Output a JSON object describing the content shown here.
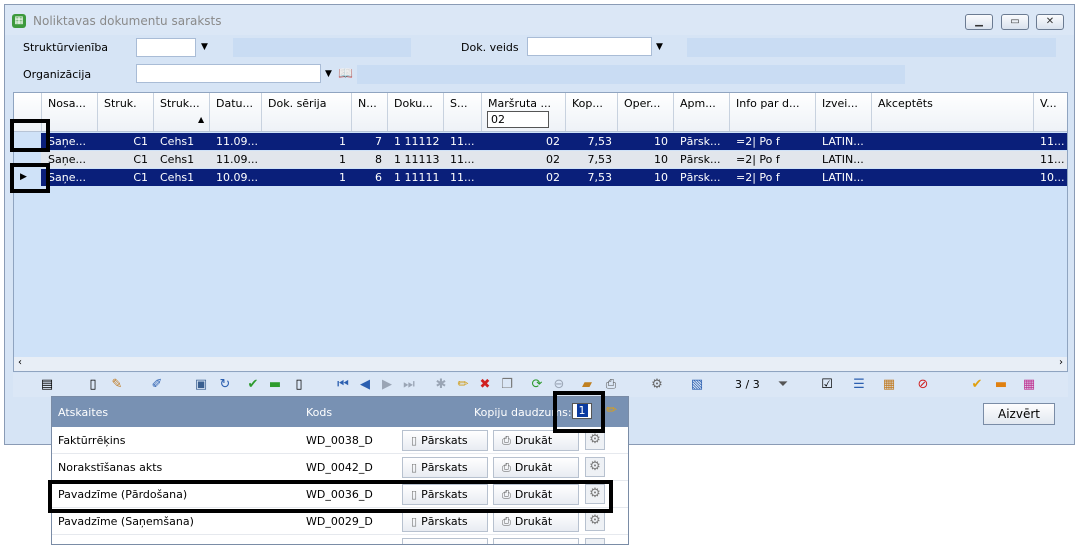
{
  "window": {
    "title": "Noliktavas dokumentu saraksts",
    "app_icon": "warehouse-app-icon"
  },
  "filters": {
    "struktur_label": "Struktūrvienība",
    "dokveids_label": "Dok. veids",
    "organizacija_label": "Organizācija"
  },
  "grid": {
    "columns": [
      "Nosa...",
      "Struk.",
      "Struk...",
      "Datu...",
      "Dok. sērija",
      "N...",
      "Doku...",
      "S...",
      "Maršruta ...",
      "Kop...",
      "Oper...",
      "Apm...",
      "Info par d...",
      "Izvei...",
      "Akceptēts",
      "V..."
    ],
    "marsruta_filter": "02",
    "rows": [
      [
        "Saņe...",
        "C1",
        "Cehs1",
        "11.09...",
        "1",
        "7",
        "1 11112",
        "11...",
        "02",
        "7,53",
        "10",
        "Pārsk...",
        "=2| Po f",
        "LATIN...",
        "",
        "11..."
      ],
      [
        "Saņe...",
        "C1",
        "Cehs1",
        "11.09...",
        "1",
        "8",
        "1 11113",
        "11...",
        "02",
        "7,53",
        "10",
        "Pārsk...",
        "=2| Po f",
        "LATIN...",
        "",
        "11..."
      ],
      [
        "Saņe...",
        "C1",
        "Cehs1",
        "10.09...",
        "1",
        "6",
        "1 11111",
        "11...",
        "02",
        "7,53",
        "10",
        "Pārsk...",
        "=2| Po f",
        "LATIN...",
        "",
        "10..."
      ]
    ]
  },
  "toolbar": {
    "record_counter": "3 / 3"
  },
  "close_button": "Aizvērt",
  "reports": {
    "header_name": "Atskaites",
    "header_code": "Kods",
    "header_copies": "Kopiju daudzums:",
    "copies_value": "1",
    "preview_label": "Pārskats",
    "print_label": "Drukāt",
    "items": [
      {
        "name": "Faktūrrēķins",
        "code": "WD_0038_D"
      },
      {
        "name": "Norakstīšanas akts",
        "code": "WD_0042_D"
      },
      {
        "name": "Pavadzīme (Pārdošana)",
        "code": "WD_0036_D"
      },
      {
        "name": "Pavadzīme (Saņemšana)",
        "code": "WD_0029_D"
      }
    ]
  },
  "colors": {
    "selected_row": "#0a1f7a",
    "window_bg": "#d6e4f5",
    "popup_header": "#7891b3"
  }
}
